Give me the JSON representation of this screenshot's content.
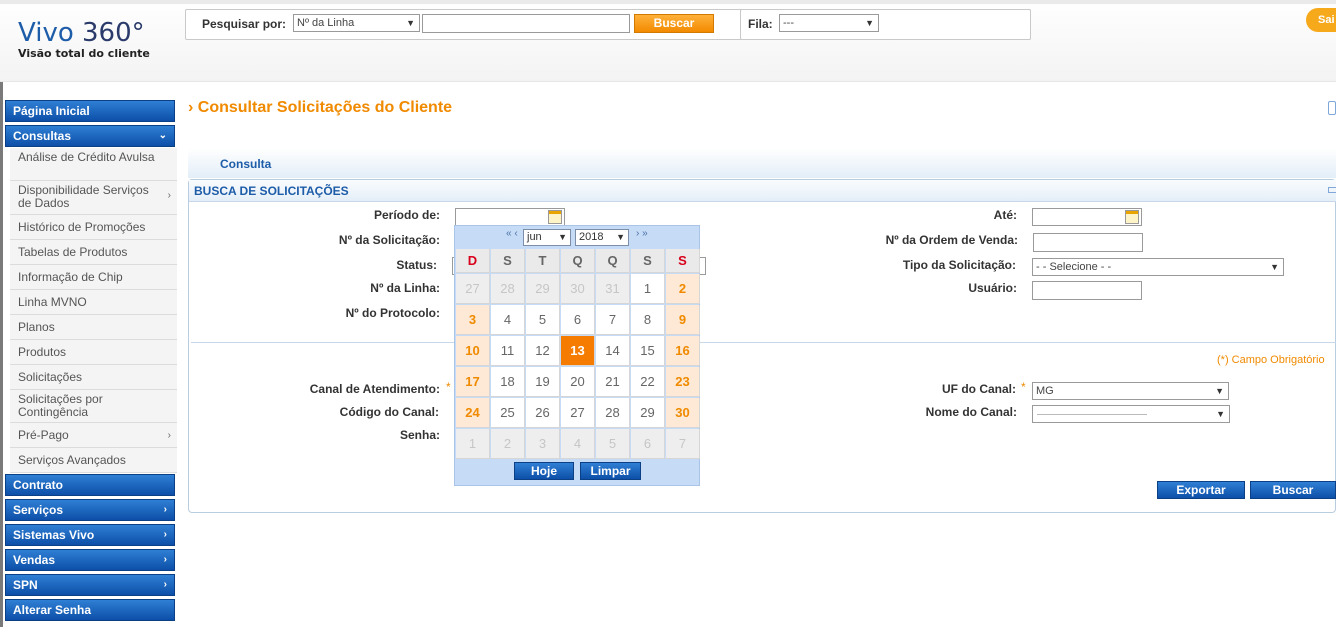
{
  "header": {
    "logo_title_main": "Vivo",
    "logo_title_rest": "360°",
    "logo_subtitle": "Visão total do cliente",
    "search_label": "Pesquisar por:",
    "search_type": "Nº da Linha",
    "search_value": "",
    "search_button": "Buscar",
    "queue_label": "Fila:",
    "queue_value": "---",
    "exit_button": "Sai"
  },
  "sidebar": {
    "pagina_inicial": "Página Inicial",
    "consultas": "Consultas",
    "sub_items": [
      {
        "label": "Análise de Crédito Avulsa",
        "chevron": false
      },
      {
        "label": "Disponibilidade Serviços de Dados",
        "chevron": true
      },
      {
        "label": "Histórico de Promoções",
        "chevron": false
      },
      {
        "label": "Tabelas de Produtos",
        "chevron": false
      },
      {
        "label": "Informação de Chip",
        "chevron": false
      },
      {
        "label": "Linha MVNO",
        "chevron": false
      },
      {
        "label": "Planos",
        "chevron": false
      },
      {
        "label": "Produtos",
        "chevron": false
      },
      {
        "label": "Solicitações",
        "chevron": false
      },
      {
        "label": "Solicitações por Contingência",
        "chevron": false
      },
      {
        "label": "Pré-Pago",
        "chevron": true
      },
      {
        "label": "Serviços Avançados",
        "chevron": false
      }
    ],
    "bottom_items": [
      {
        "label": "Contrato",
        "chevron": false
      },
      {
        "label": "Serviços",
        "chevron": true
      },
      {
        "label": "Sistemas Vivo",
        "chevron": true
      },
      {
        "label": "Vendas",
        "chevron": true
      },
      {
        "label": "SPN",
        "chevron": true
      },
      {
        "label": "Alterar Senha",
        "chevron": false
      }
    ]
  },
  "main": {
    "title": "Consultar Solicitações do Cliente",
    "tab": "Consulta",
    "panel_title": "BUSCA DE SOLICITAÇÕES",
    "labels": {
      "periodo": "Período de:",
      "ate": "Até:",
      "num_solicitacao": "Nº da Solicitação:",
      "num_ordem": "Nº da Ordem de Venda:",
      "status": "Status:",
      "tipo_solicitacao": "Tipo da Solicitação:",
      "num_linha": "Nº da Linha:",
      "usuario": "Usuário:",
      "num_protocolo": "Nº do Protocolo:",
      "canal_atendimento": "Canal de Atendimento:",
      "uf_canal": "UF do Canal:",
      "codigo_canal": "Código do Canal:",
      "nome_canal": "Nome do Canal:",
      "senha": "Senha:"
    },
    "tipo_solicitacao_value": "- - Selecione - -",
    "uf_canal_value": "MG",
    "required_note": "(*) Campo Obrigatório",
    "required_mark": "*",
    "export_button": "Exportar",
    "search_button": "Buscar"
  },
  "calendar": {
    "prev": "« ‹",
    "next": "› »",
    "month": "jun",
    "year": "2018",
    "weekdays": [
      "D",
      "S",
      "T",
      "Q",
      "Q",
      "S",
      "S"
    ],
    "weeks": [
      [
        {
          "d": "27",
          "t": "other"
        },
        {
          "d": "28",
          "t": "other"
        },
        {
          "d": "29",
          "t": "other"
        },
        {
          "d": "30",
          "t": "other"
        },
        {
          "d": "31",
          "t": "other"
        },
        {
          "d": "1",
          "t": "normal"
        },
        {
          "d": "2",
          "t": "weekend"
        }
      ],
      [
        {
          "d": "3",
          "t": "weekend"
        },
        {
          "d": "4",
          "t": "normal"
        },
        {
          "d": "5",
          "t": "normal"
        },
        {
          "d": "6",
          "t": "normal"
        },
        {
          "d": "7",
          "t": "normal"
        },
        {
          "d": "8",
          "t": "normal"
        },
        {
          "d": "9",
          "t": "weekend"
        }
      ],
      [
        {
          "d": "10",
          "t": "weekend"
        },
        {
          "d": "11",
          "t": "normal"
        },
        {
          "d": "12",
          "t": "normal"
        },
        {
          "d": "13",
          "t": "today"
        },
        {
          "d": "14",
          "t": "normal"
        },
        {
          "d": "15",
          "t": "normal"
        },
        {
          "d": "16",
          "t": "weekend"
        }
      ],
      [
        {
          "d": "17",
          "t": "weekend"
        },
        {
          "d": "18",
          "t": "normal"
        },
        {
          "d": "19",
          "t": "normal"
        },
        {
          "d": "20",
          "t": "normal"
        },
        {
          "d": "21",
          "t": "normal"
        },
        {
          "d": "22",
          "t": "normal"
        },
        {
          "d": "23",
          "t": "weekend"
        }
      ],
      [
        {
          "d": "24",
          "t": "weekend"
        },
        {
          "d": "25",
          "t": "normal"
        },
        {
          "d": "26",
          "t": "normal"
        },
        {
          "d": "27",
          "t": "normal"
        },
        {
          "d": "28",
          "t": "normal"
        },
        {
          "d": "29",
          "t": "normal"
        },
        {
          "d": "30",
          "t": "weekend"
        }
      ],
      [
        {
          "d": "1",
          "t": "other"
        },
        {
          "d": "2",
          "t": "other"
        },
        {
          "d": "3",
          "t": "other"
        },
        {
          "d": "4",
          "t": "other"
        },
        {
          "d": "5",
          "t": "other"
        },
        {
          "d": "6",
          "t": "other"
        },
        {
          "d": "7",
          "t": "other"
        }
      ]
    ],
    "today_button": "Hoje",
    "clear_button": "Limpar"
  },
  "colors": {
    "accent": "#f08a00",
    "brand_blue": "#1d5ca8",
    "today": "#f57c00"
  }
}
